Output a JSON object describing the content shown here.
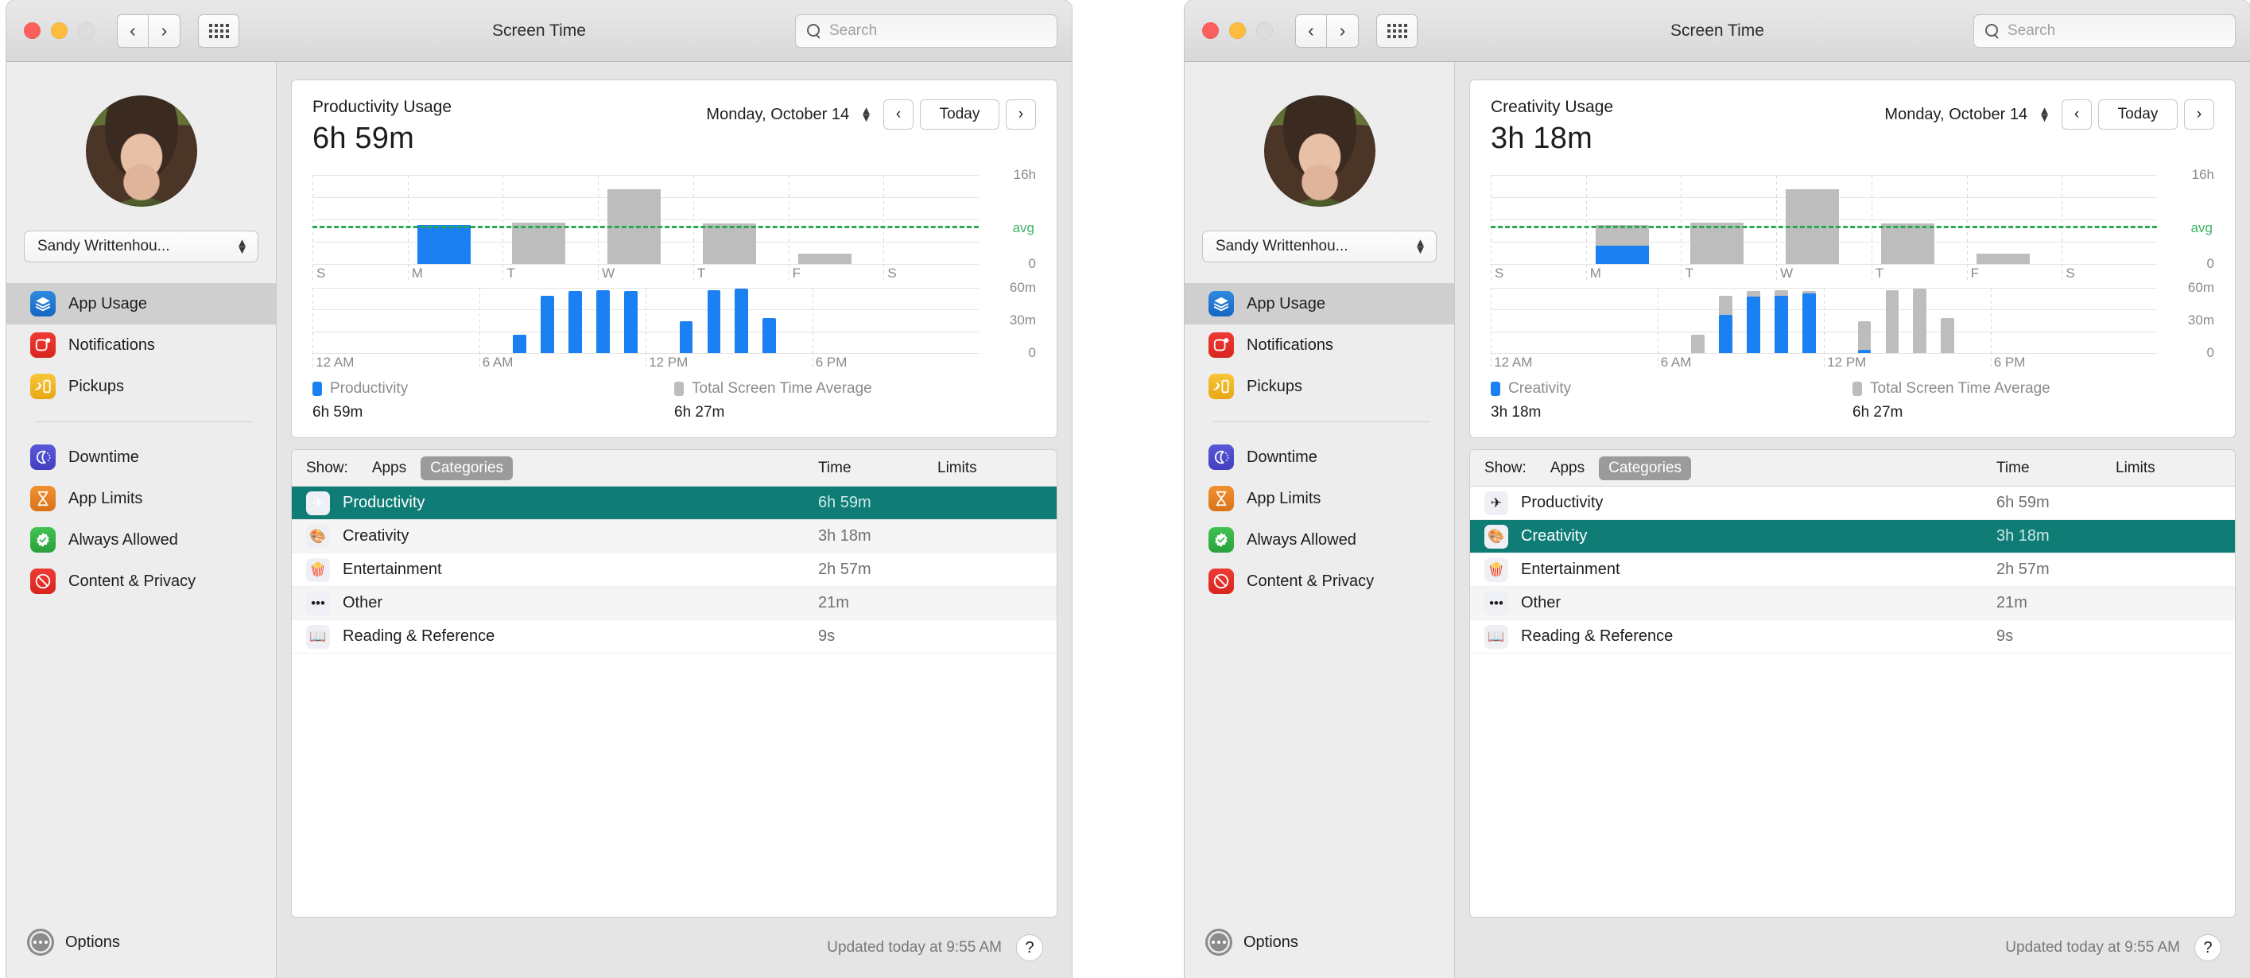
{
  "windows": [
    {
      "id": "left",
      "titlebar": {
        "title": "Screen Time",
        "back_icon": "chevron-left-icon",
        "forward_icon": "chevron-right-icon",
        "grid_icon": "grid-icon",
        "search_placeholder": "Search",
        "search_value": ""
      },
      "sidebar": {
        "avatar_alt": "user-avatar",
        "user_name": "Sandy Writtenhou...",
        "items": [
          {
            "label": "App Usage",
            "icon": "layers-icon",
            "color": "#2f8ade",
            "active": true
          },
          {
            "label": "Notifications",
            "icon": "bell-badge-icon",
            "color": "#ef3b36",
            "active": false
          },
          {
            "label": "Pickups",
            "icon": "phone-hand-icon",
            "color": "#f7c63a",
            "active": false
          },
          {
            "label": "Downtime",
            "icon": "hourglass-moon-icon",
            "color": "#5a57d8",
            "active": false
          },
          {
            "label": "App Limits",
            "icon": "hourglass-icon",
            "color": "#f0912e",
            "active": false
          },
          {
            "label": "Always Allowed",
            "icon": "check-badge-icon",
            "color": "#41c352",
            "active": false
          },
          {
            "label": "Content & Privacy",
            "icon": "no-entry-icon",
            "color": "#ef3b36",
            "active": false
          }
        ],
        "options_label": "Options",
        "options_icon": "ellipsis-circle-icon"
      },
      "usage": {
        "title": "Productivity Usage",
        "total": "6h 59m",
        "date": "Monday, October 14",
        "stepper_icon": "stepper-icon",
        "prev_icon": "chevron-left-icon",
        "today_label": "Today",
        "next_icon": "chevron-right-icon"
      },
      "legend": {
        "primary_name": "Productivity",
        "primary_value": "6h 59m",
        "primary_color": "#1b80f2",
        "average_name": "Total Screen Time Average",
        "average_value": "6h 27m",
        "average_color": "#bdbdbd"
      },
      "table": {
        "show_label": "Show:",
        "tab_apps": "Apps",
        "tab_categories": "Categories",
        "selected_tab": "Categories",
        "col_time": "Time",
        "col_limits": "Limits",
        "rows": [
          {
            "name": "Productivity",
            "time": "6h 59m",
            "limits": "",
            "icon": "paper-plane-icon",
            "glyph": "✈",
            "selected": true
          },
          {
            "name": "Creativity",
            "time": "3h 18m",
            "limits": "",
            "icon": "palette-icon",
            "glyph": "🎨",
            "selected": false
          },
          {
            "name": "Entertainment",
            "time": "2h 57m",
            "limits": "",
            "icon": "popcorn-icon",
            "glyph": "🍿",
            "selected": false
          },
          {
            "name": "Other",
            "time": "21m",
            "limits": "",
            "icon": "ellipsis-icon",
            "glyph": "•••",
            "selected": false
          },
          {
            "name": "Reading & Reference",
            "time": "9s",
            "limits": "",
            "icon": "book-icon",
            "glyph": "📖",
            "selected": false
          }
        ]
      },
      "status": {
        "updated": "Updated today at 9:55 AM",
        "help_label": "?"
      }
    },
    {
      "id": "right",
      "titlebar": {
        "title": "Screen Time",
        "back_icon": "chevron-left-icon",
        "forward_icon": "chevron-right-icon",
        "grid_icon": "grid-icon",
        "search_placeholder": "Search",
        "search_value": ""
      },
      "sidebar": {
        "avatar_alt": "user-avatar",
        "user_name": "Sandy Writtenhou...",
        "items": [
          {
            "label": "App Usage",
            "icon": "layers-icon",
            "color": "#2f8ade",
            "active": true
          },
          {
            "label": "Notifications",
            "icon": "bell-badge-icon",
            "color": "#ef3b36",
            "active": false
          },
          {
            "label": "Pickups",
            "icon": "phone-hand-icon",
            "color": "#f7c63a",
            "active": false
          },
          {
            "label": "Downtime",
            "icon": "hourglass-moon-icon",
            "color": "#5a57d8",
            "active": false
          },
          {
            "label": "App Limits",
            "icon": "hourglass-icon",
            "color": "#f0912e",
            "active": false
          },
          {
            "label": "Always Allowed",
            "icon": "check-badge-icon",
            "color": "#41c352",
            "active": false
          },
          {
            "label": "Content & Privacy",
            "icon": "no-entry-icon",
            "color": "#ef3b36",
            "active": false
          }
        ],
        "options_label": "Options",
        "options_icon": "ellipsis-circle-icon"
      },
      "usage": {
        "title": "Creativity Usage",
        "total": "3h 18m",
        "date": "Monday, October 14",
        "stepper_icon": "stepper-icon",
        "prev_icon": "chevron-left-icon",
        "today_label": "Today",
        "next_icon": "chevron-right-icon"
      },
      "legend": {
        "primary_name": "Creativity",
        "primary_value": "3h 18m",
        "primary_color": "#1b80f2",
        "average_name": "Total Screen Time Average",
        "average_value": "6h 27m",
        "average_color": "#bdbdbd"
      },
      "table": {
        "show_label": "Show:",
        "tab_apps": "Apps",
        "tab_categories": "Categories",
        "selected_tab": "Categories",
        "col_time": "Time",
        "col_limits": "Limits",
        "rows": [
          {
            "name": "Productivity",
            "time": "6h 59m",
            "limits": "",
            "icon": "paper-plane-icon",
            "glyph": "✈",
            "selected": false
          },
          {
            "name": "Creativity",
            "time": "3h 18m",
            "limits": "",
            "icon": "palette-icon",
            "glyph": "🎨",
            "selected": true
          },
          {
            "name": "Entertainment",
            "time": "2h 57m",
            "limits": "",
            "icon": "popcorn-icon",
            "glyph": "🍿",
            "selected": false
          },
          {
            "name": "Other",
            "time": "21m",
            "limits": "",
            "icon": "ellipsis-icon",
            "glyph": "•••",
            "selected": false
          },
          {
            "name": "Reading & Reference",
            "time": "9s",
            "limits": "",
            "icon": "book-icon",
            "glyph": "📖",
            "selected": false
          }
        ]
      },
      "status": {
        "updated": "Updated today at 9:55 AM",
        "help_label": "?"
      }
    }
  ],
  "chart_data": [
    {
      "id": "left-week",
      "type": "bar",
      "title": "Productivity Usage — weekly",
      "categories": [
        "S",
        "M",
        "T",
        "W",
        "T",
        "F",
        "S"
      ],
      "series": [
        {
          "name": "Total Screen Time",
          "color": "#bdbdbd",
          "values": [
            0,
            0,
            7.5,
            13.5,
            7.3,
            1.8,
            0
          ]
        },
        {
          "name": "Productivity",
          "color": "#1b80f2",
          "values": [
            0,
            6.98,
            0,
            0,
            0,
            0,
            0
          ]
        }
      ],
      "ylabel": "",
      "xlabel": "",
      "ylim": [
        0,
        16
      ],
      "yticks": [
        0,
        16
      ],
      "ytick_labels": [
        "0",
        "16h"
      ],
      "average_line": {
        "value": 6.45,
        "label": "avg",
        "color": "#2aaa4e",
        "style": "dashed"
      },
      "grid": true,
      "legend_position": "below"
    },
    {
      "id": "left-hourly",
      "type": "bar",
      "title": "Productivity Usage — hourly",
      "x": [
        "12 AM",
        "1 AM",
        "2 AM",
        "3 AM",
        "4 AM",
        "5 AM",
        "6 AM",
        "7 AM",
        "8 AM",
        "9 AM",
        "10 AM",
        "11 AM",
        "12 PM",
        "1 PM",
        "2 PM",
        "3 PM",
        "4 PM",
        "5 PM",
        "6 PM",
        "7 PM",
        "8 PM",
        "9 PM",
        "10 PM",
        "11 PM"
      ],
      "series": [
        {
          "name": "Productivity",
          "color": "#1b80f2",
          "values": [
            0,
            0,
            0,
            0,
            0,
            0,
            0,
            17,
            53,
            57,
            58,
            57,
            0,
            29,
            58,
            59,
            32,
            0,
            0,
            0,
            0,
            0,
            0,
            0
          ]
        }
      ],
      "ylim": [
        0,
        60
      ],
      "yticks": [
        0,
        30,
        60
      ],
      "ytick_labels": [
        "0",
        "30m",
        "60m"
      ],
      "xtick_labels": [
        "12 AM",
        "6 AM",
        "12 PM",
        "6 PM"
      ],
      "grid": true
    },
    {
      "id": "right-week",
      "type": "bar",
      "title": "Creativity Usage — weekly",
      "categories": [
        "S",
        "M",
        "T",
        "W",
        "T",
        "F",
        "S"
      ],
      "series": [
        {
          "name": "Total Screen Time",
          "color": "#bdbdbd",
          "values": [
            0,
            6.98,
            7.5,
            13.5,
            7.3,
            1.8,
            0
          ]
        },
        {
          "name": "Creativity",
          "color": "#1b80f2",
          "values": [
            0,
            3.3,
            0,
            0,
            0,
            0,
            0
          ]
        }
      ],
      "ylim": [
        0,
        16
      ],
      "yticks": [
        0,
        16
      ],
      "ytick_labels": [
        "0",
        "16h"
      ],
      "average_line": {
        "value": 6.45,
        "label": "avg",
        "color": "#2aaa4e",
        "style": "dashed"
      },
      "grid": true,
      "legend_position": "below"
    },
    {
      "id": "right-hourly",
      "type": "bar",
      "title": "Creativity Usage — hourly",
      "x": [
        "12 AM",
        "1 AM",
        "2 AM",
        "3 AM",
        "4 AM",
        "5 AM",
        "6 AM",
        "7 AM",
        "8 AM",
        "9 AM",
        "10 AM",
        "11 AM",
        "12 PM",
        "1 PM",
        "2 PM",
        "3 PM",
        "4 PM",
        "5 PM",
        "6 PM",
        "7 PM",
        "8 PM",
        "9 PM",
        "10 PM",
        "11 PM"
      ],
      "series": [
        {
          "name": "Total Screen Time",
          "color": "#bdbdbd",
          "values": [
            0,
            0,
            0,
            0,
            0,
            0,
            0,
            17,
            53,
            57,
            58,
            57,
            0,
            29,
            58,
            59,
            32,
            0,
            0,
            0,
            0,
            0,
            0,
            0
          ]
        },
        {
          "name": "Creativity",
          "color": "#1b80f2",
          "values": [
            0,
            0,
            0,
            0,
            0,
            0,
            0,
            0,
            35,
            52,
            53,
            55,
            0,
            3,
            0,
            0,
            0,
            0,
            0,
            0,
            0,
            0,
            0,
            0
          ]
        }
      ],
      "ylim": [
        0,
        60
      ],
      "yticks": [
        0,
        30,
        60
      ],
      "ytick_labels": [
        "0",
        "30m",
        "60m"
      ],
      "xtick_labels": [
        "12 AM",
        "6 AM",
        "12 PM",
        "6 PM"
      ],
      "grid": true
    }
  ]
}
